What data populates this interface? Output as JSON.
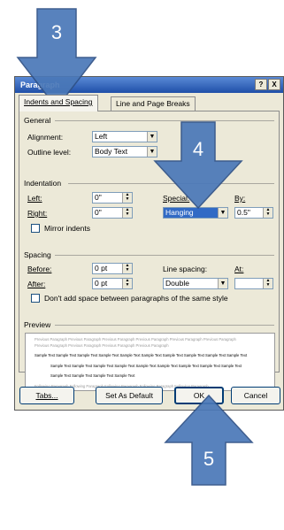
{
  "dialog": {
    "title": "Paragraph",
    "help_btn": "?",
    "close_btn": "X",
    "tabs": [
      "Indents and Spacing",
      "Line and Page Breaks"
    ],
    "general": {
      "title": "General",
      "alignment_label": "Alignment:",
      "alignment_value": "Left",
      "outline_label": "Outline level:",
      "outline_value": "Body Text"
    },
    "indentation": {
      "title": "Indentation",
      "left_label": "Left:",
      "left_value": "0\"",
      "right_label": "Right:",
      "right_value": "0\"",
      "special_label": "Special:",
      "special_value": "Hanging",
      "by_label": "By:",
      "by_value": "0.5\"",
      "mirror_label": "Mirror indents"
    },
    "spacing": {
      "title": "Spacing",
      "before_label": "Before:",
      "before_value": "0 pt",
      "after_label": "After:",
      "after_value": "0 pt",
      "line_spacing_label": "Line spacing:",
      "line_spacing_value": "Double",
      "at_label": "At:",
      "at_value": "",
      "dont_add_label": "Don't add space between paragraphs of the same style"
    },
    "preview": {
      "title": "Preview",
      "prev_line_1": "Previous Paragraph Previous Paragraph Previous Paragraph Previous Paragraph Previous Paragraph Previous Paragraph",
      "prev_line_2": "Previous Paragraph Previous Paragraph Previous Paragraph Previous Paragraph",
      "sample_line_1": "Sample Text Sample Text Sample Text Sample Text Sample Text Sample Text Sample Text Sample Text Sample Text Sample Text",
      "sample_line_2": "Sample Text Sample Text Sample Text Sample Text Sample Text Sample Text Sample Text Sample Text Sample Text",
      "sample_line_3": "Sample Text Sample Text Sample Text Sample Text",
      "follow_line": "Following Paragraph Following Paragraph Following Paragraph Following Paragraph Following Paragraph"
    },
    "buttons": {
      "tabs": "Tabs...",
      "set_default": "Set As Default",
      "ok": "OK",
      "cancel": "Cancel"
    }
  },
  "callouts": [
    "3",
    "4",
    "5"
  ],
  "colors": {
    "arrow_fill": "#4a78b8",
    "arrow_stroke": "#2f5186",
    "selected_bg": "#316ac5"
  }
}
